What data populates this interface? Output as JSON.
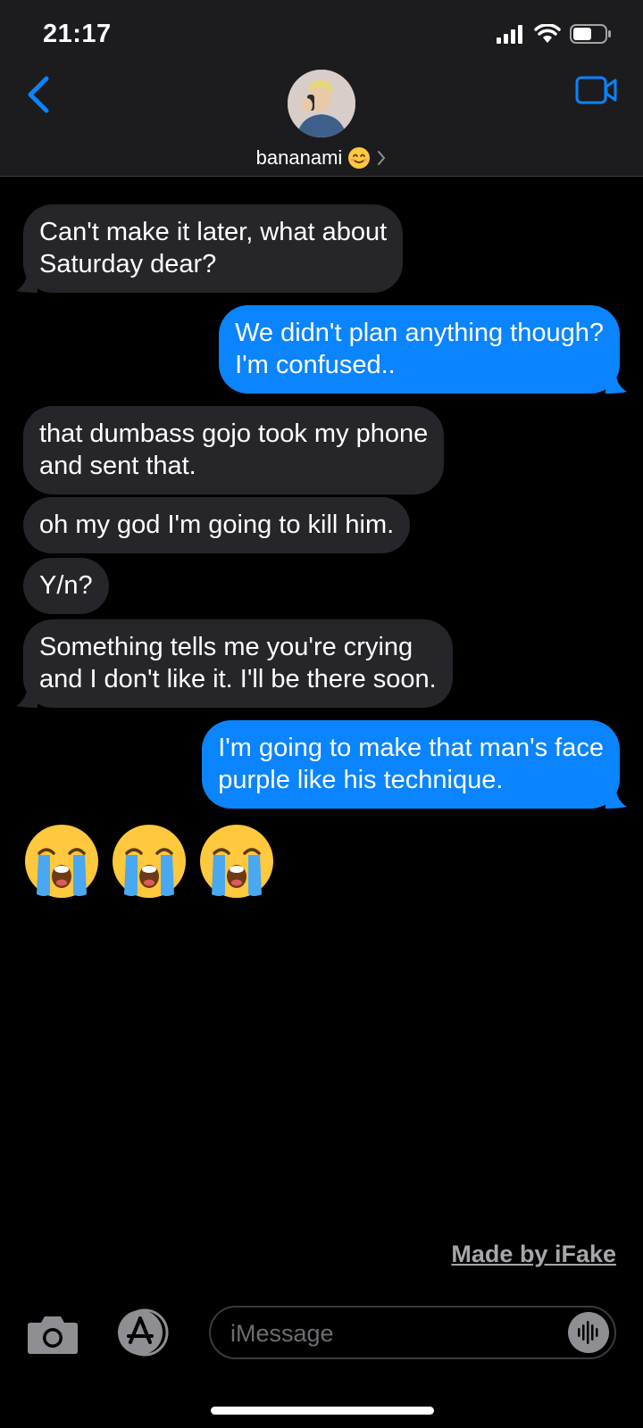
{
  "status_bar": {
    "time": "21:17"
  },
  "header": {
    "contact_name": "bananami",
    "contact_emoji": "smiling-face-icon"
  },
  "messages": [
    {
      "from": "them",
      "lines": [
        "Can't make it later, what about",
        "Saturday dear?"
      ]
    },
    {
      "from": "me",
      "lines": [
        "We didn't plan anything though?",
        "I'm confused.."
      ]
    },
    {
      "from": "them",
      "lines": [
        "that dumbass gojo took my phone",
        "and sent that."
      ]
    },
    {
      "from": "them",
      "lines": [
        "oh my god I'm going to kill him."
      ]
    },
    {
      "from": "them",
      "lines": [
        "Y/n?"
      ]
    },
    {
      "from": "them",
      "lines": [
        "Something tells me you're crying",
        "and I don't like it. I'll be there soon."
      ]
    },
    {
      "from": "me",
      "lines": [
        "I'm going to make that man's face",
        "purple like his technique."
      ]
    }
  ],
  "emoji_message": {
    "icons": [
      "loudly-crying-face-icon",
      "loudly-crying-face-icon",
      "loudly-crying-face-icon"
    ]
  },
  "watermark": "Made by iFake",
  "composer": {
    "placeholder": "iMessage"
  },
  "colors": {
    "incoming_bubble": "#26252a",
    "outgoing_bubble": "#0a84ff",
    "accent": "#0a84ff",
    "background": "#000000",
    "header": "#1c1c1e"
  }
}
